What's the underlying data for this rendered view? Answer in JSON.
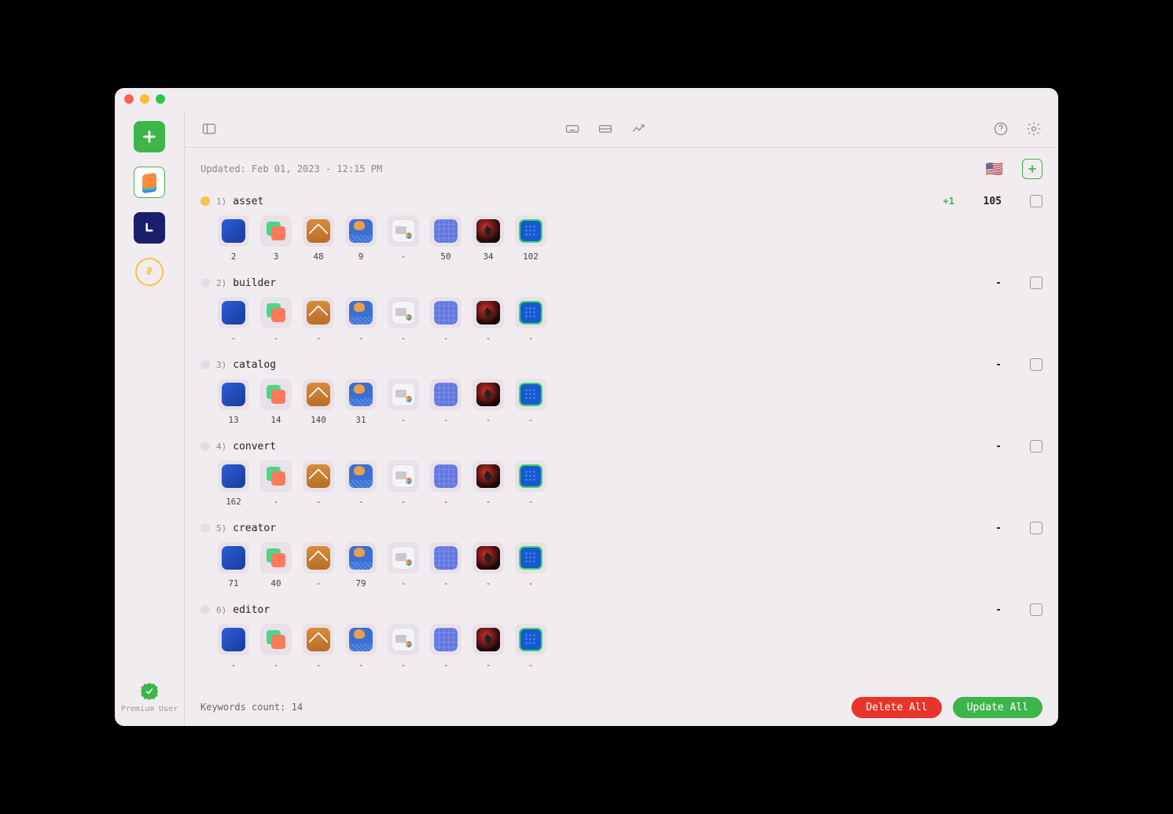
{
  "sidebar": {
    "premium_label": "Premium User"
  },
  "toolbar": {},
  "status": {
    "updated_text": "Updated: Feb 01, 2023 - 12:15 PM",
    "flag": "🇺🇸"
  },
  "keywords": [
    {
      "status": "yellow",
      "index": "1)",
      "name": "asset",
      "delta": "+1",
      "count": "105",
      "ranks": [
        "2",
        "3",
        "48",
        "9",
        "-",
        "50",
        "34",
        "102"
      ]
    },
    {
      "status": "grey",
      "index": "2)",
      "name": "builder",
      "delta": "",
      "count": "-",
      "ranks": [
        "-",
        "-",
        "-",
        "-",
        "-",
        "-",
        "-",
        "-"
      ]
    },
    {
      "status": "grey",
      "index": "3)",
      "name": "catalog",
      "delta": "",
      "count": "-",
      "ranks": [
        "13",
        "14",
        "140",
        "31",
        "-",
        "-",
        "-",
        "-"
      ]
    },
    {
      "status": "grey",
      "index": "4)",
      "name": "convert",
      "delta": "",
      "count": "-",
      "ranks": [
        "162",
        "-",
        "-",
        "-",
        "-",
        "-",
        "-",
        "-"
      ]
    },
    {
      "status": "grey",
      "index": "5)",
      "name": "creator",
      "delta": "",
      "count": "-",
      "ranks": [
        "71",
        "40",
        "-",
        "79",
        "-",
        "-",
        "-",
        "-"
      ]
    },
    {
      "status": "grey",
      "index": "6)",
      "name": "editor",
      "delta": "",
      "count": "-",
      "ranks": [
        "-",
        "-",
        "-",
        "-",
        "-",
        "-",
        "-",
        "-"
      ]
    }
  ],
  "footer": {
    "keywords_count_label": "Keywords count: 14",
    "delete_all_label": "Delete All",
    "update_all_label": "Update All"
  }
}
